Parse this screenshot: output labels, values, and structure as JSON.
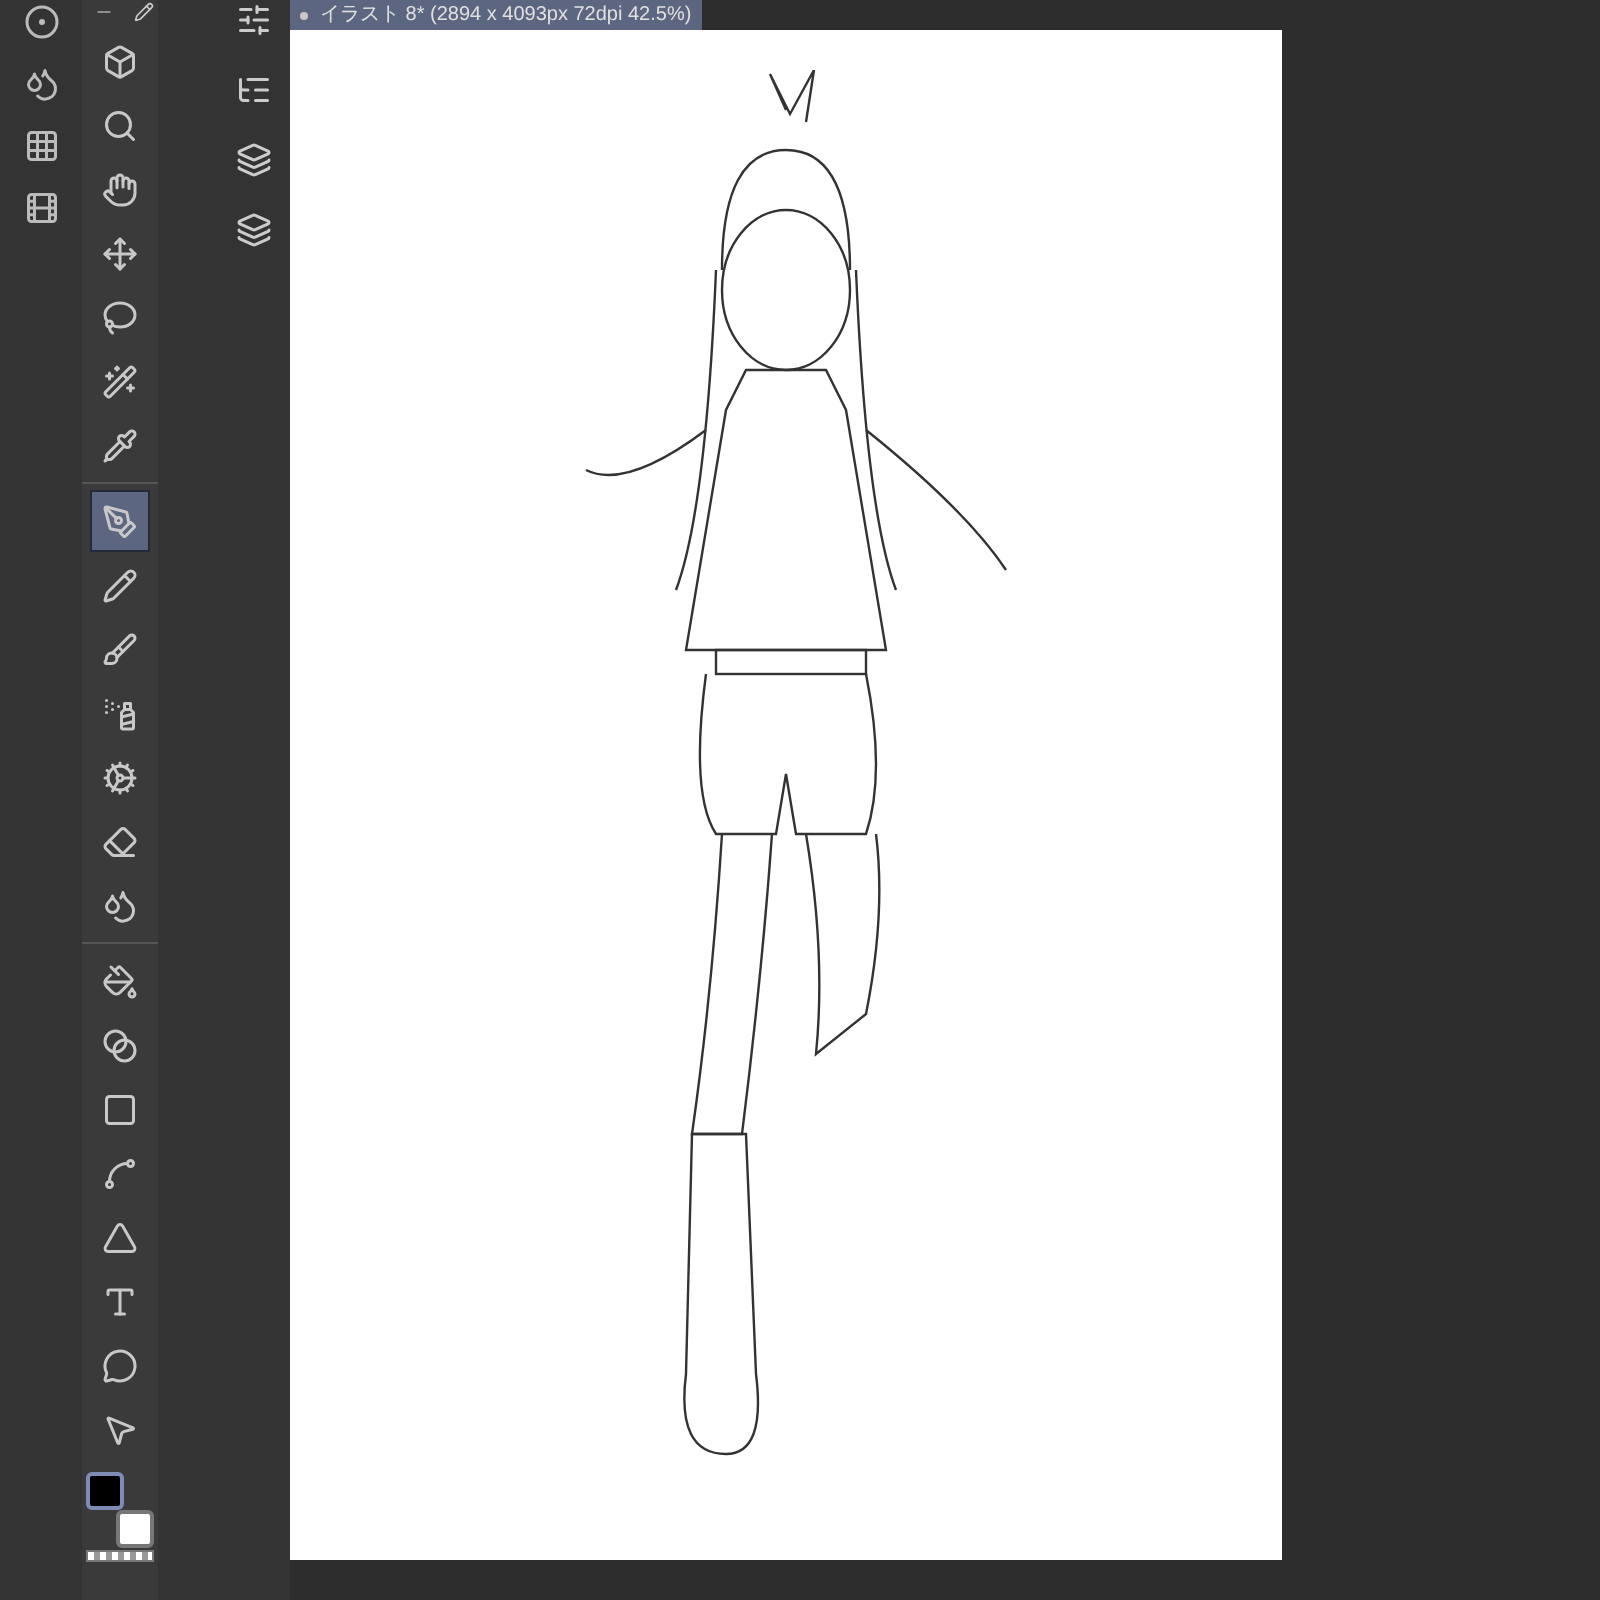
{
  "document_tab": {
    "title": "イラスト 8* (2894 x 4093px 72dpi 42.5%)",
    "modified": true
  },
  "tool_groups": [
    [
      {
        "selected": false
      },
      {
        "selected": false
      },
      {
        "selected": false
      },
      {
        "selected": false
      },
      {
        "selected": false
      },
      {
        "selected": false
      },
      {
        "selected": false
      }
    ],
    [
      {
        "selected": true
      },
      {
        "selected": false
      },
      {
        "selected": false
      },
      {
        "selected": false
      },
      {
        "selected": false
      },
      {
        "selected": false
      },
      {
        "selected": false
      }
    ],
    [
      {
        "selected": false
      },
      {
        "selected": false
      },
      {
        "selected": false
      },
      {
        "selected": false
      },
      {
        "selected": false
      },
      {
        "selected": false
      },
      {
        "selected": false
      },
      {
        "selected": false
      }
    ]
  ],
  "color_swatches": [
    {
      "color": "#000000",
      "selected": true
    },
    {
      "color": "#ffffff",
      "selected": false
    }
  ]
}
